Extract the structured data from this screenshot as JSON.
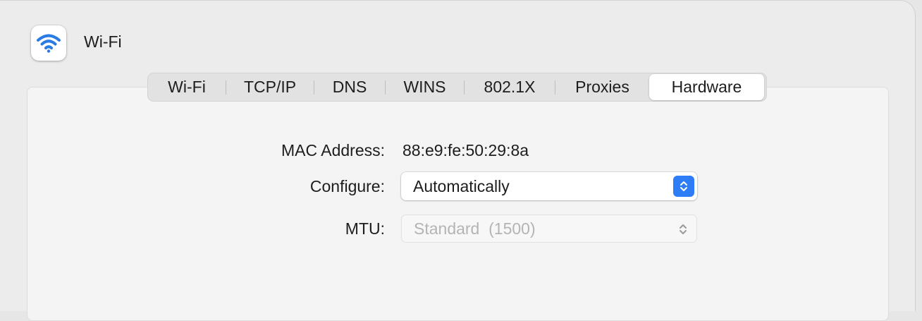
{
  "header": {
    "title": "Wi-Fi",
    "icon": "wifi-icon"
  },
  "tabs": [
    {
      "label": "Wi-Fi",
      "active": false
    },
    {
      "label": "TCP/IP",
      "active": false
    },
    {
      "label": "DNS",
      "active": false
    },
    {
      "label": "WINS",
      "active": false
    },
    {
      "label": "802.1X",
      "active": false
    },
    {
      "label": "Proxies",
      "active": false
    },
    {
      "label": "Hardware",
      "active": true
    }
  ],
  "hardware": {
    "mac_label": "MAC Address:",
    "mac_value": "88:e9:fe:50:29:8a",
    "configure_label": "Configure:",
    "configure_value": "Automatically",
    "mtu_label": "MTU:",
    "mtu_value": "Standard  (1500)"
  },
  "colors": {
    "accent": "#2f7df6",
    "wifi_icon": "#2b7be5",
    "disabled_text": "#b4b4b4"
  }
}
